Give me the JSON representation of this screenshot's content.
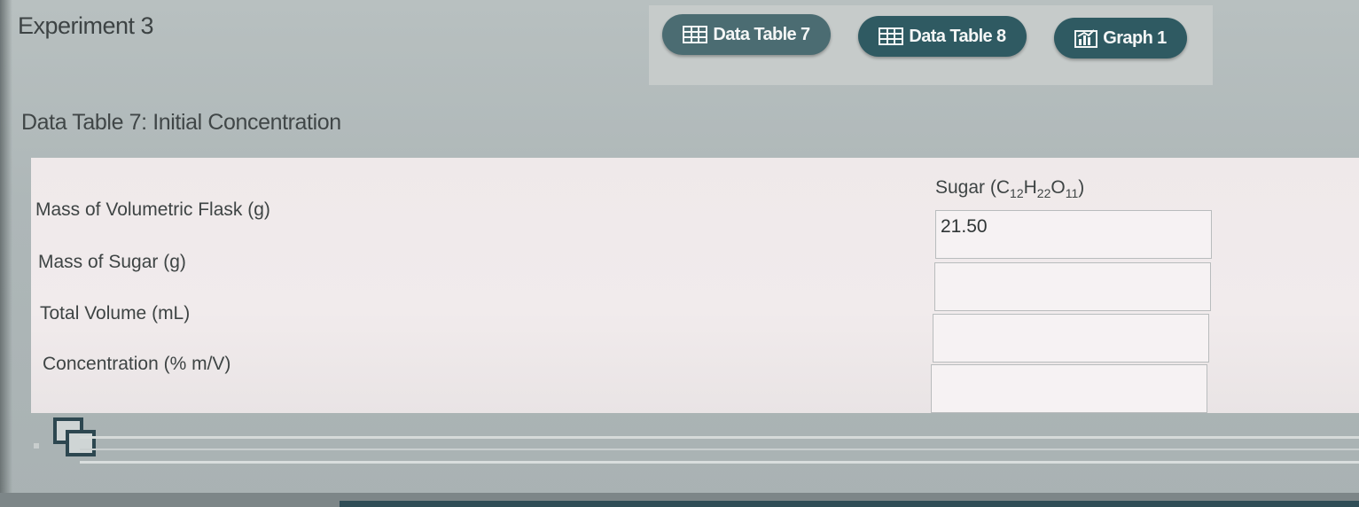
{
  "experiment": {
    "title": "Experiment 3"
  },
  "tabs": [
    {
      "label": "Data Table 7",
      "icon": "table-icon"
    },
    {
      "label": "Data Table 8",
      "icon": "table-icon"
    },
    {
      "label": "Graph 1",
      "icon": "graph-icon"
    }
  ],
  "section": {
    "title": "Data Table 7: Initial Concentration"
  },
  "table": {
    "column_header": {
      "text": "Sugar (",
      "c": "C",
      "c_sub": "12",
      "h": "H",
      "h_sub": "22",
      "o": "O",
      "o_sub": "11",
      "close": ")"
    },
    "rows": [
      {
        "label": "Mass of Volumetric Flask (g)",
        "value": "21.50"
      },
      {
        "label": "Mass of Sugar (g)",
        "value": ""
      },
      {
        "label": "Total Volume (mL)",
        "value": ""
      },
      {
        "label": "Concentration (% m/V)",
        "value": ""
      }
    ]
  },
  "colors": {
    "tab_bg": "#2f5a62",
    "tab_text": "#f4f6f6",
    "card_bg": "#efe9ea"
  }
}
